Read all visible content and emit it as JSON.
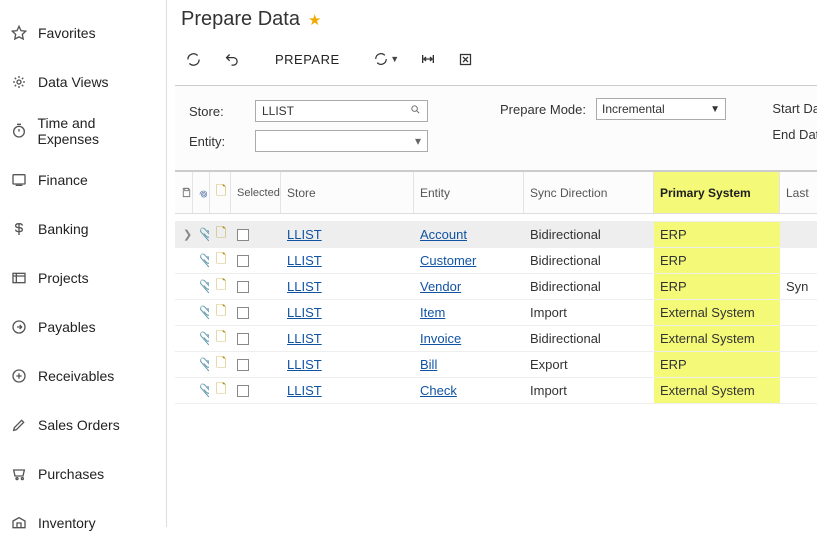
{
  "sidebar": {
    "items": [
      {
        "label": "Favorites",
        "icon": "star"
      },
      {
        "label": "Data Views",
        "icon": "dataviews"
      },
      {
        "label": "Time and Expenses",
        "icon": "clock"
      },
      {
        "label": "Finance",
        "icon": "finance"
      },
      {
        "label": "Banking",
        "icon": "banking"
      },
      {
        "label": "Projects",
        "icon": "projects"
      },
      {
        "label": "Payables",
        "icon": "payables"
      },
      {
        "label": "Receivables",
        "icon": "receivables"
      },
      {
        "label": "Sales Orders",
        "icon": "salesorders"
      },
      {
        "label": "Purchases",
        "icon": "purchases"
      },
      {
        "label": "Inventory",
        "icon": "inventory"
      }
    ]
  },
  "page": {
    "title": "Prepare Data"
  },
  "toolbar": {
    "prepare": "PREPARE"
  },
  "filter": {
    "store_label": "Store:",
    "store_value": "LLIST",
    "entity_label": "Entity:",
    "entity_value": "",
    "prepare_mode_label": "Prepare Mode:",
    "prepare_mode_value": "Incremental",
    "start_date_label": "Start Da",
    "end_date_label": "End Dat"
  },
  "grid": {
    "headers": {
      "selected": "Selected",
      "store": "Store",
      "entity": "Entity",
      "sync": "Sync Direction",
      "primary": "Primary System",
      "last": "Last"
    },
    "rows": [
      {
        "store": "LLIST",
        "entity": "Account",
        "sync": "Bidirectional",
        "primary": "ERP",
        "last": ""
      },
      {
        "store": "LLIST",
        "entity": "Customer",
        "sync": "Bidirectional",
        "primary": "ERP",
        "last": ""
      },
      {
        "store": "LLIST",
        "entity": "Vendor",
        "sync": "Bidirectional",
        "primary": "ERP",
        "last": "Syn"
      },
      {
        "store": "LLIST",
        "entity": "Item",
        "sync": "Import",
        "primary": "External System",
        "last": ""
      },
      {
        "store": "LLIST",
        "entity": "Invoice",
        "sync": "Bidirectional",
        "primary": "External System",
        "last": ""
      },
      {
        "store": "LLIST",
        "entity": "Bill",
        "sync": "Export",
        "primary": "ERP",
        "last": ""
      },
      {
        "store": "LLIST",
        "entity": "Check",
        "sync": "Import",
        "primary": "External System",
        "last": ""
      }
    ]
  }
}
